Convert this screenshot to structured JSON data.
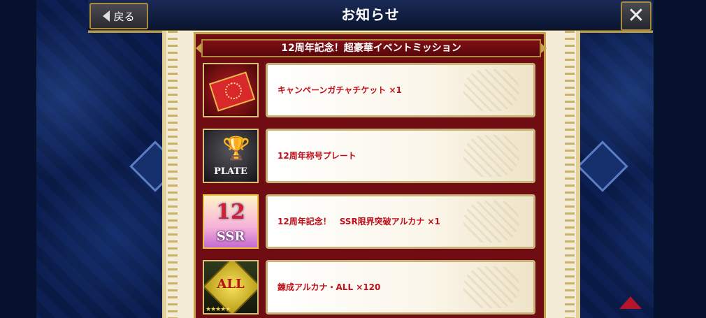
{
  "header": {
    "title": "お知らせ",
    "back_label": "戻る",
    "close_label": "✕"
  },
  "event": {
    "title": "12周年記念！超豪華イベントミッション"
  },
  "rewards": [
    {
      "icon": "gacha-ticket-icon",
      "text": "キャンペーンガチャチケット ×1"
    },
    {
      "icon": "title-plate-icon",
      "icon_label": "PLATE",
      "text": "12周年称号プレート"
    },
    {
      "icon": "ssr-limit-break-icon",
      "icon_number": "12",
      "icon_label": "SSR",
      "text": "12周年記念！　SSR限界突破アルカナ ×1"
    },
    {
      "icon": "all-refine-arcana-icon",
      "icon_label": "ALL",
      "icon_stars": "★★★★★",
      "text": "錬成アルカナ・ALL ×120"
    }
  ],
  "colors": {
    "panel": "#6f0d12",
    "reward_text": "#c0101a",
    "gold_border": "#c8a24a"
  }
}
